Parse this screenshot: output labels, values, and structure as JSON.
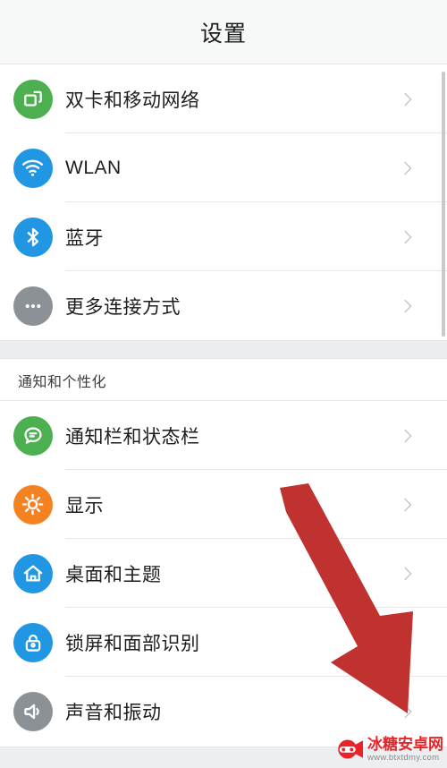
{
  "header": {
    "title": "设置"
  },
  "colors": {
    "accent_green": "#4cb050",
    "accent_blue": "#2196e3",
    "accent_orange": "#f58220",
    "accent_gray": "#8c9196",
    "arrow_red": "#c0322f",
    "watermark_red": "#e8232a",
    "page_bg": "#ffffff",
    "bar_bg": "#f7f8f8",
    "divider": "#e6e8ea",
    "gap_bg": "#ebedef",
    "chevron": "#c3c5c7"
  },
  "sections": [
    {
      "title": null,
      "items": [
        {
          "label": "双卡和移动网络",
          "icon": "sim-cards-icon",
          "icon_color": "#4cb050"
        },
        {
          "label": "WLAN",
          "icon": "wifi-icon",
          "icon_color": "#2196e3"
        },
        {
          "label": "蓝牙",
          "icon": "bluetooth-icon",
          "icon_color": "#2196e3"
        },
        {
          "label": "更多连接方式",
          "icon": "more-dots-icon",
          "icon_color": "#8c9196"
        }
      ]
    },
    {
      "title": "通知和个性化",
      "items": [
        {
          "label": "通知栏和状态栏",
          "icon": "notification-chat-icon",
          "icon_color": "#4cb050"
        },
        {
          "label": "显示",
          "icon": "brightness-icon",
          "icon_color": "#f58220"
        },
        {
          "label": "桌面和主题",
          "icon": "home-icon",
          "icon_color": "#2196e3"
        },
        {
          "label": "锁屏和面部识别",
          "icon": "lock-icon",
          "icon_color": "#2196e3"
        },
        {
          "label": "声音和振动",
          "icon": "speaker-icon",
          "icon_color": "#8c9196"
        }
      ]
    }
  ],
  "annotation": {
    "arrow": {
      "name": "red-down-right-arrow",
      "color": "#c0322f",
      "from": "(315, 545)",
      "to": "(455, 795)"
    }
  },
  "watermark": {
    "brand": "冰糖安卓网",
    "url": "www.btxtdmy.com"
  }
}
